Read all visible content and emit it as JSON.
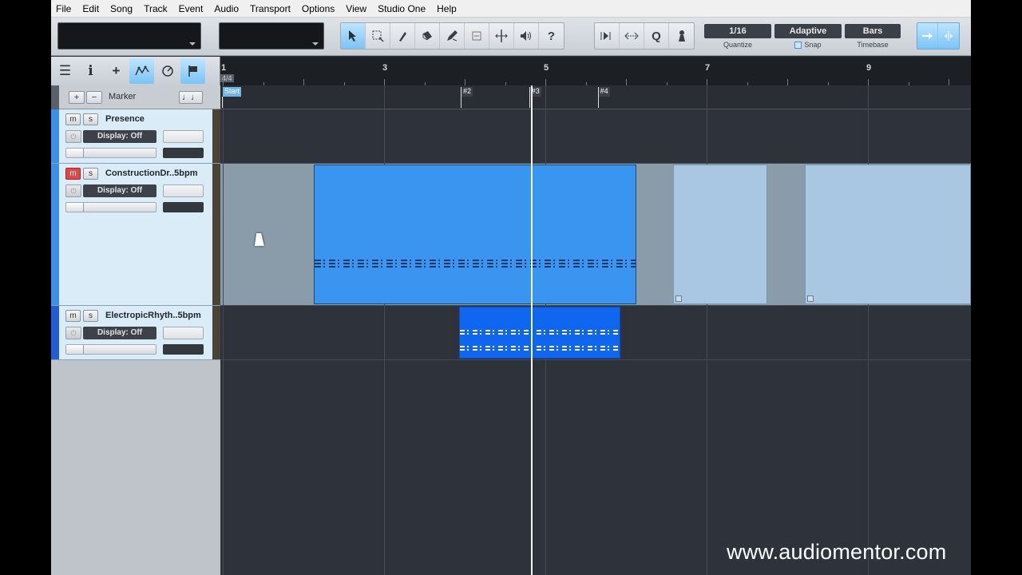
{
  "menu": [
    "File",
    "Edit",
    "Song",
    "Track",
    "Event",
    "Audio",
    "Transport",
    "Options",
    "View",
    "Studio One",
    "Help"
  ],
  "toolbar": {
    "tools": [
      "arrow-tool-icon",
      "range-tool-icon",
      "split-tool-icon",
      "eraser-tool-icon",
      "pencil-tool-icon",
      "mute-tool-icon",
      "bend-tool-icon",
      "listen-tool-icon",
      "help-icon"
    ],
    "help_label": "?",
    "quantize_value": "1/16",
    "quantize_label": "Quantize",
    "snap_value": "Adaptive",
    "snap_label": "Snap",
    "timebase_value": "Bars",
    "timebase_label": "Timebase",
    "nudge_q_label": "Q"
  },
  "track_tools": {
    "list_glyph": "☰",
    "info_glyph": "i",
    "add_glyph": "+"
  },
  "marker_track": {
    "add_label": "+",
    "remove_label": "−",
    "name": "Marker",
    "notes_glyph": "♩♩"
  },
  "ruler": {
    "signature": "4/4",
    "bars": [
      {
        "label": "1",
        "bar": 1
      },
      {
        "label": "3",
        "bar": 3
      },
      {
        "label": "5",
        "bar": 5
      },
      {
        "label": "7",
        "bar": 7
      },
      {
        "label": "9",
        "bar": 9
      }
    ]
  },
  "markers": [
    {
      "label": "Start",
      "bar": 1.0,
      "kind": "start"
    },
    {
      "label": "#2",
      "bar": 3.95,
      "kind": "normal"
    },
    {
      "label": "#3",
      "bar": 4.8,
      "kind": "normal"
    },
    {
      "label": "#4",
      "bar": 5.65,
      "kind": "normal"
    }
  ],
  "playhead_bar": 4.82,
  "tracks": [
    {
      "name": "Presence",
      "mute": "m",
      "solo": "s",
      "muted": false,
      "display": "Display: Off",
      "color": "#3a8fe6"
    },
    {
      "name": "ConstructionDr..5bpm",
      "mute": "m",
      "solo": "s",
      "muted": true,
      "display": "Display: Off",
      "color": "#3a8fe6"
    },
    {
      "name": "ElectropicRhyth..5bpm",
      "mute": "m",
      "solo": "s",
      "muted": false,
      "display": "Display: Off",
      "color": "#1f5cd6"
    }
  ],
  "events": [
    {
      "track": 1,
      "start_bar": 2.13,
      "end_bar": 6.13,
      "style": "bright"
    },
    {
      "track": 1,
      "start_bar": 6.58,
      "end_bar": 7.75,
      "style": "pale"
    },
    {
      "track": 1,
      "start_bar": 8.22,
      "end_bar": 10.3,
      "style": "pale"
    },
    {
      "track": 2,
      "start_bar": 3.93,
      "end_bar": 5.93,
      "style": "deep"
    }
  ],
  "watermark": "www.audiomentor.com"
}
